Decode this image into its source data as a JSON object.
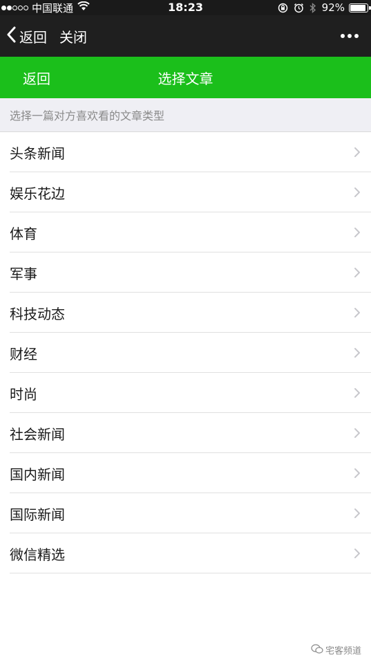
{
  "status_bar": {
    "signal_full": 2,
    "signal_total": 5,
    "carrier": "中国联通",
    "time": "18:23",
    "battery_pct": "92%",
    "battery_level": 0.92
  },
  "title_bar": {
    "back_label": "返回",
    "close_label": "关闭"
  },
  "header": {
    "back_label": "返回",
    "title": "选择文章",
    "accent_color": "#1bbf1b"
  },
  "hint": "选择一篇对方喜欢看的文章类型",
  "categories": [
    {
      "label": "头条新闻"
    },
    {
      "label": "娱乐花边"
    },
    {
      "label": "体育"
    },
    {
      "label": "军事"
    },
    {
      "label": "科技动态"
    },
    {
      "label": "财经"
    },
    {
      "label": "时尚"
    },
    {
      "label": "社会新闻"
    },
    {
      "label": "国内新闻"
    },
    {
      "label": "国际新闻"
    },
    {
      "label": "微信精选"
    }
  ],
  "watermark": "宅客频道"
}
